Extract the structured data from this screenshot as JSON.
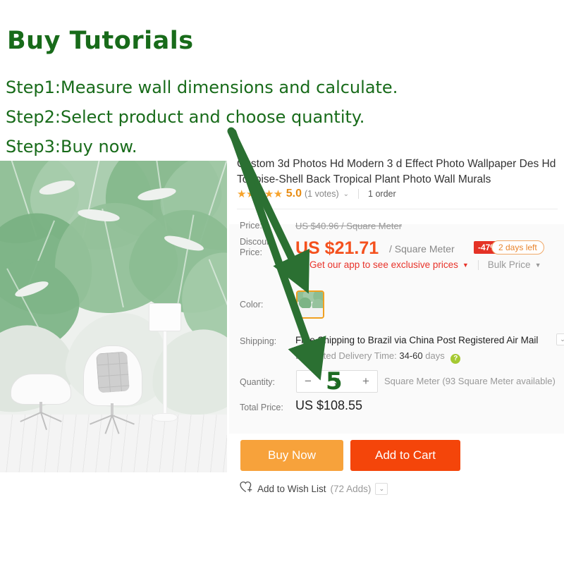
{
  "tutorial": {
    "title": "Buy Tutorials",
    "steps": [
      "Step1:Measure wall dimensions and calculate.",
      "Step2:Select product and choose quantity.",
      "Step3:Buy now."
    ],
    "annotation_value": "5",
    "accent_color": "#186b1a"
  },
  "product": {
    "title": "Custom 3d Photos Hd Modern 3 d Effect Photo Wallpaper Des Hd Tortoise-Shell Back Tropical Plant Photo Wall Murals",
    "stars": "★★★★★",
    "rating": "5.0",
    "votes": "(1 votes)",
    "orders": "1 order",
    "rating_chevron": "⌄"
  },
  "price": {
    "price_label": "Price:",
    "original": "US $40.96 / Square Meter",
    "discount_label": "Discount Price:",
    "discount": "US $21.71",
    "unit": "/ Square Meter",
    "discount_pct": "-47%",
    "time_left": "2 days left",
    "app_promo": "Get our app to see exclusive prices",
    "app_chevron": "▼",
    "bulk": "Bulk Price",
    "bulk_chevron": "▼",
    "discount_color": "#f4511e",
    "badge_color": "#e43226"
  },
  "color": {
    "label": "Color:",
    "selected_swatch": "tropical-plant-mural"
  },
  "shipping": {
    "label": "Shipping:",
    "method": "Free Shipping to Brazil via China Post Registered Air Mail",
    "select_chevron": "⌄",
    "delivery_prefix": "Estimated Delivery Time:",
    "delivery_value": "34-60",
    "delivery_suffix": "days",
    "help": "?"
  },
  "quantity": {
    "label": "Quantity:",
    "minus": "−",
    "value": "5",
    "plus": "+",
    "unit_note": "Square Meter (93 Square Meter available)"
  },
  "total": {
    "label": "Total Price:",
    "value": "US $108.55"
  },
  "actions": {
    "buy_now": "Buy Now",
    "add_to_cart": "Add to Cart",
    "buy_color": "#f7a23b",
    "cart_color": "#f4450a",
    "wish_list": "Add to Wish List",
    "wish_count": "(72 Adds)",
    "wish_chevron": "⌄"
  }
}
